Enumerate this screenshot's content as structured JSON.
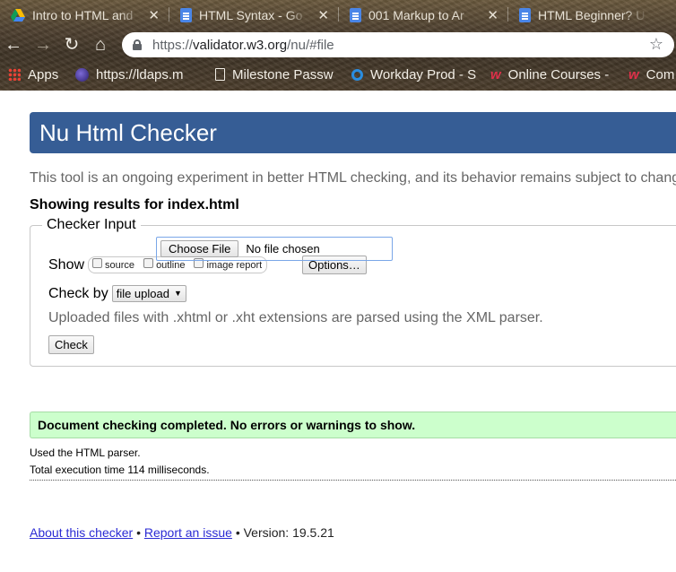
{
  "browser": {
    "tabs": [
      {
        "title": "Intro to HTML and",
        "icon": "google-drive-icon"
      },
      {
        "title": "HTML Syntax - Go",
        "icon": "google-docs-icon"
      },
      {
        "title": "001 Markup to Ar",
        "icon": "google-docs-icon"
      },
      {
        "title": "HTML Beginner? U",
        "icon": "google-docs-icon"
      }
    ],
    "url_scheme": "https://",
    "url_host": "validator.w3.org",
    "url_path": "/nu/#file",
    "bookmarks": [
      {
        "label": "Apps",
        "icon": "apps-grid-icon"
      },
      {
        "label": "https://ldaps.m",
        "icon": "site-orb-icon"
      },
      {
        "label": "Milestone Passw",
        "icon": "page-icon"
      },
      {
        "label": "Workday Prod - S",
        "icon": "workday-ring-icon"
      },
      {
        "label": "Online Courses -",
        "icon": "w-logo-icon"
      },
      {
        "label": "Com",
        "icon": "w-logo-icon"
      }
    ]
  },
  "page": {
    "title": "Nu Html Checker",
    "intro": "This tool is an ongoing experiment in better HTML checking, and its behavior remains subject to change",
    "results_for": "Showing results for index.html",
    "checker_input": {
      "legend": "Checker Input",
      "show_label": "Show",
      "show_options": [
        "source",
        "outline",
        "image report"
      ],
      "options_button": "Options…",
      "check_by_label": "Check by",
      "check_by_selected": "file upload",
      "choose_file_button": "Choose File",
      "file_status": "No file chosen",
      "hint": "Uploaded files with .xhtml or .xht extensions are parsed using the XML parser.",
      "check_button": "Check"
    },
    "result_message": "Document checking completed. No errors or warnings to show.",
    "details": [
      "Used the HTML parser.",
      "Total execution time 114 milliseconds."
    ],
    "footer": {
      "about_link": "About this checker",
      "separator": "•",
      "report_link": "Report an issue",
      "version": "Version: 19.5.21"
    }
  },
  "colors": {
    "banner": "#365d95",
    "success_bg": "#ccffcc",
    "link": "#2b2bd4"
  }
}
